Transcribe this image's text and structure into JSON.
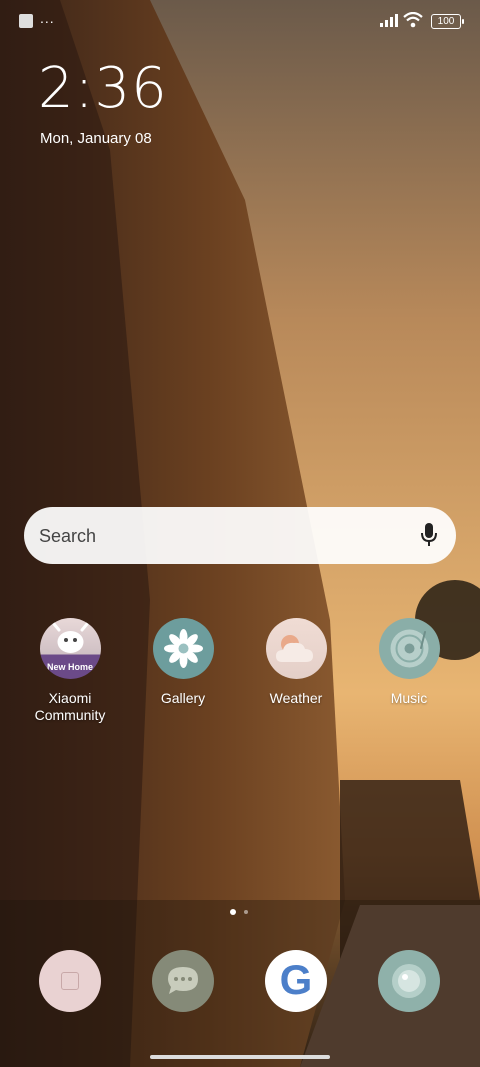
{
  "status_bar": {
    "battery": "100",
    "notification_indicator": "..."
  },
  "clock": {
    "time": "2:36",
    "date": "Mon, January 08"
  },
  "search": {
    "placeholder": "Search"
  },
  "apps": [
    {
      "label": "Xiaomi Community",
      "badge": "New Home",
      "icon": "xiaomi-community-icon"
    },
    {
      "label": "Gallery",
      "icon": "gallery-flower-icon"
    },
    {
      "label": "Weather",
      "icon": "weather-cloud-icon"
    },
    {
      "label": "Music",
      "icon": "music-disc-icon"
    }
  ],
  "dock": [
    {
      "icon": "themes-icon"
    },
    {
      "icon": "messages-icon"
    },
    {
      "icon": "google-icon",
      "text": "G"
    },
    {
      "icon": "camera-icon"
    }
  ],
  "colors": {
    "gallery": "#6d9d9d",
    "music": "#8aaea8",
    "weather": "#e8cfc4",
    "xiaomi": "#6b4a88"
  }
}
